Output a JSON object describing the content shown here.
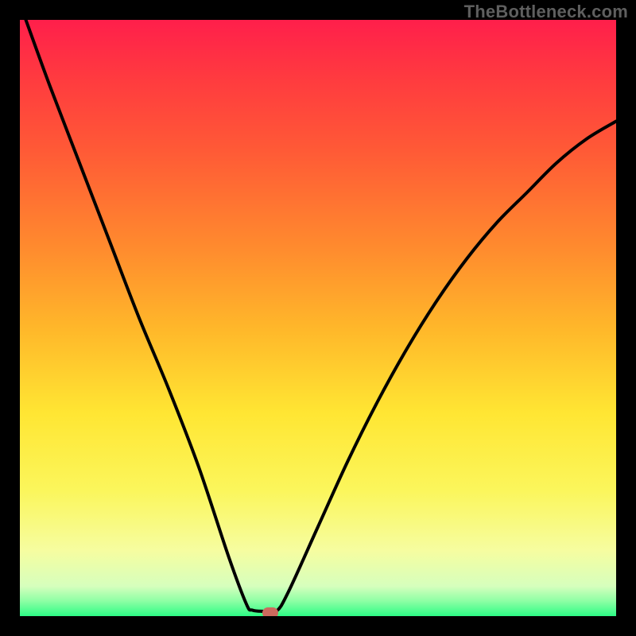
{
  "watermark": "TheBottleneck.com",
  "chart_data": {
    "type": "line",
    "title": "",
    "xlabel": "",
    "ylabel": "",
    "xlim": [
      0,
      100
    ],
    "ylim": [
      0,
      100
    ],
    "background_gradient_stops": [
      {
        "pct": 0,
        "color": "#ff1f4b"
      },
      {
        "pct": 10,
        "color": "#ff3b3f"
      },
      {
        "pct": 22,
        "color": "#ff5a36"
      },
      {
        "pct": 38,
        "color": "#ff8a2e"
      },
      {
        "pct": 52,
        "color": "#ffb82a"
      },
      {
        "pct": 66,
        "color": "#ffe633"
      },
      {
        "pct": 79,
        "color": "#fbf65c"
      },
      {
        "pct": 89,
        "color": "#f6fda0"
      },
      {
        "pct": 95,
        "color": "#d6ffbd"
      },
      {
        "pct": 97.5,
        "color": "#8cffa4"
      },
      {
        "pct": 100,
        "color": "#2dfc85"
      }
    ],
    "curve": {
      "minimum_x": 41,
      "points": [
        {
          "x": 1,
          "y": 100
        },
        {
          "x": 5,
          "y": 89
        },
        {
          "x": 10,
          "y": 76
        },
        {
          "x": 15,
          "y": 63
        },
        {
          "x": 20,
          "y": 50
        },
        {
          "x": 25,
          "y": 38
        },
        {
          "x": 30,
          "y": 25
        },
        {
          "x": 35,
          "y": 10
        },
        {
          "x": 38,
          "y": 2
        },
        {
          "x": 39,
          "y": 1
        },
        {
          "x": 41,
          "y": 0.8
        },
        {
          "x": 43,
          "y": 0.8
        },
        {
          "x": 45,
          "y": 4
        },
        {
          "x": 50,
          "y": 15
        },
        {
          "x": 55,
          "y": 26
        },
        {
          "x": 60,
          "y": 36
        },
        {
          "x": 65,
          "y": 45
        },
        {
          "x": 70,
          "y": 53
        },
        {
          "x": 75,
          "y": 60
        },
        {
          "x": 80,
          "y": 66
        },
        {
          "x": 85,
          "y": 71
        },
        {
          "x": 90,
          "y": 76
        },
        {
          "x": 95,
          "y": 80
        },
        {
          "x": 100,
          "y": 83
        }
      ]
    },
    "marker": {
      "x": 42,
      "y": 0.5,
      "color": "#cc6a5e"
    }
  }
}
